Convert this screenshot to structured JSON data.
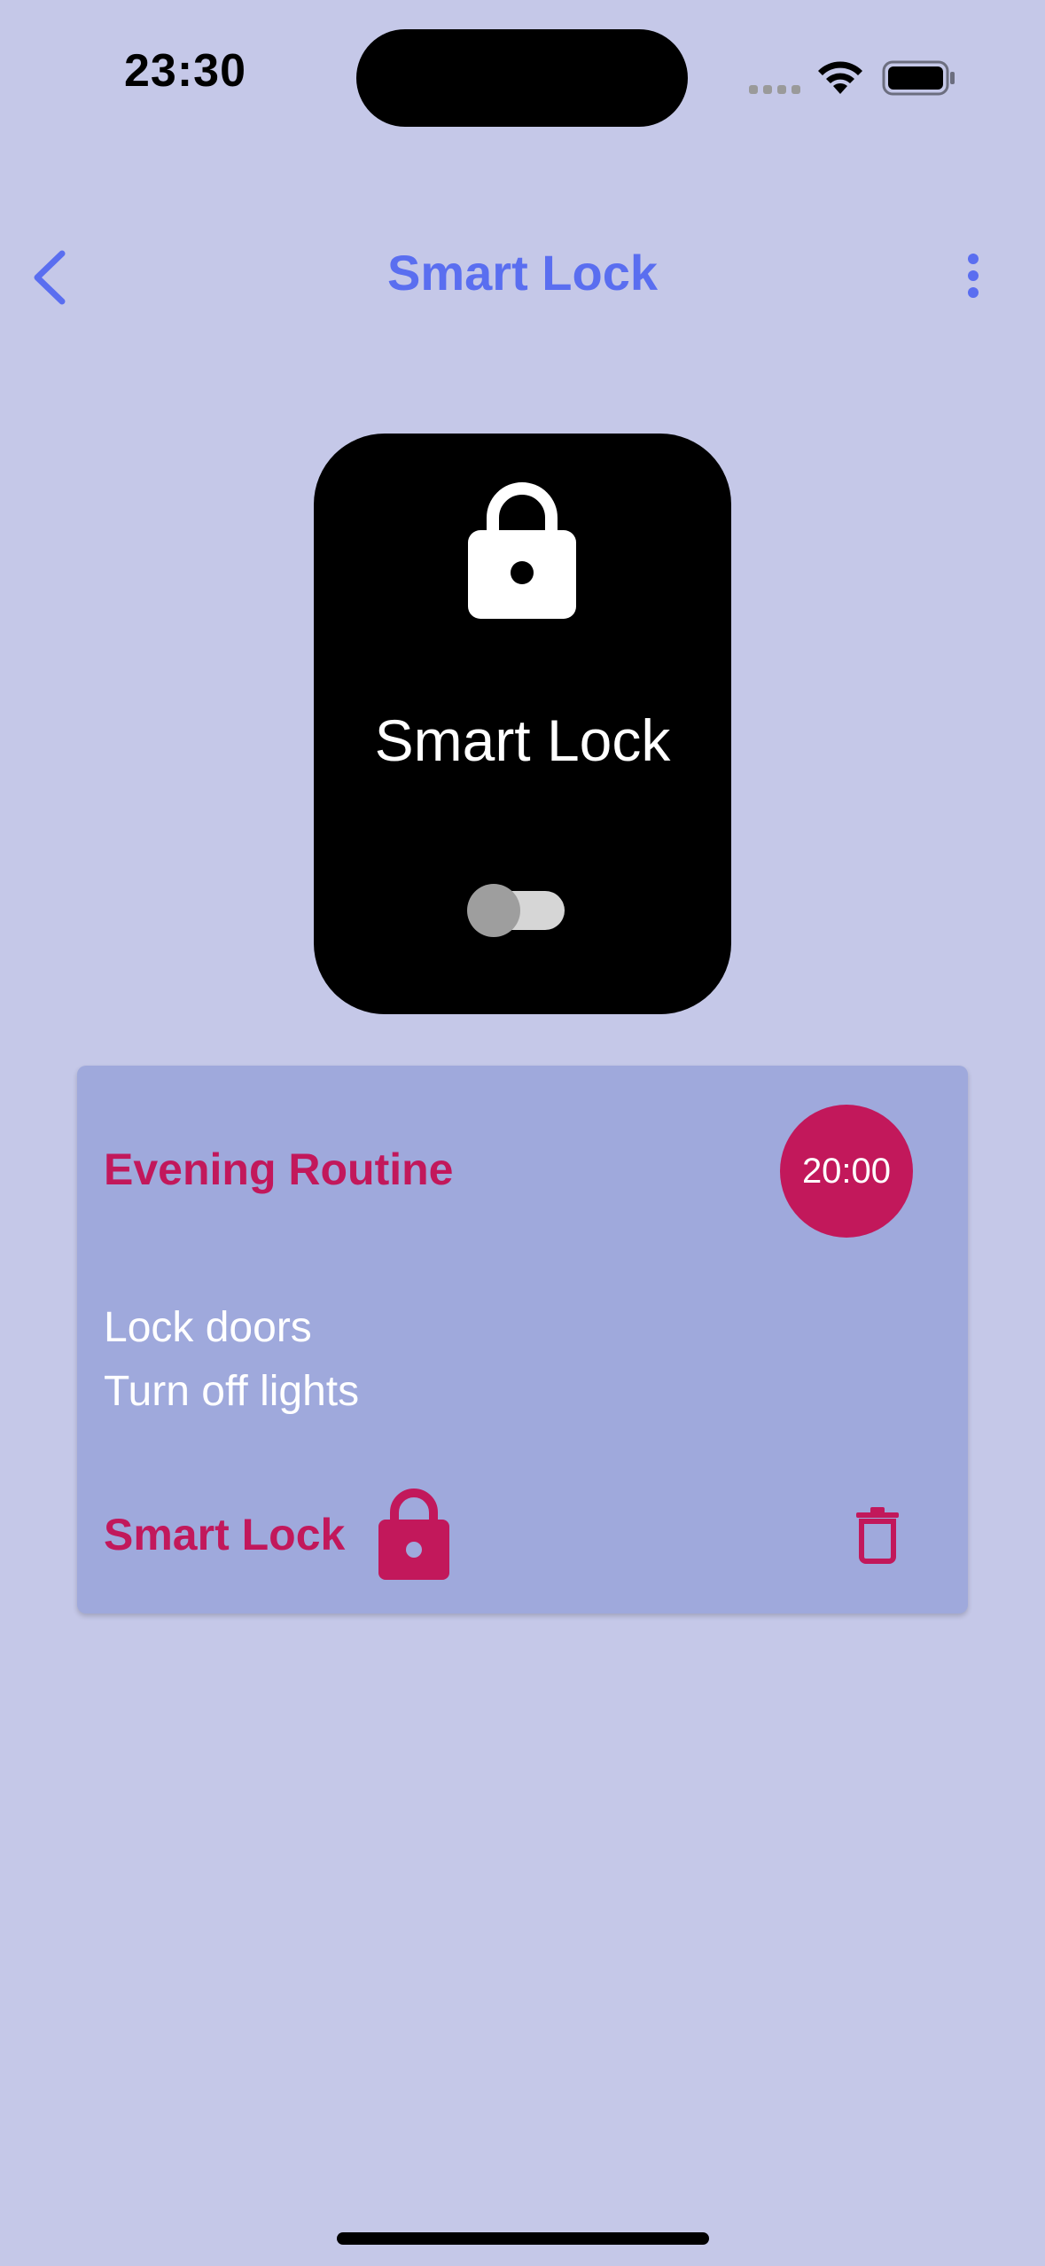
{
  "status_bar": {
    "time": "23:30",
    "signal_icon": "signal-dots-icon",
    "wifi_icon": "wifi-icon",
    "battery_icon": "battery-icon"
  },
  "nav": {
    "title": "Smart Lock",
    "back_icon": "chevron-left-icon",
    "more_icon": "more-vertical-icon"
  },
  "device": {
    "name": "Smart Lock",
    "icon": "lock-icon",
    "toggle_on": false
  },
  "routine": {
    "title": "Evening Routine",
    "time": "20:00",
    "actions": [
      "Lock doors",
      "Turn off lights"
    ],
    "device_label": "Smart Lock",
    "device_icon": "lock-icon",
    "delete_icon": "trash-icon"
  },
  "colors": {
    "background": "#c5c8e8",
    "accent_blue": "#5a6ef0",
    "accent_pink": "#c2185b",
    "card": "#9fa9dc"
  }
}
